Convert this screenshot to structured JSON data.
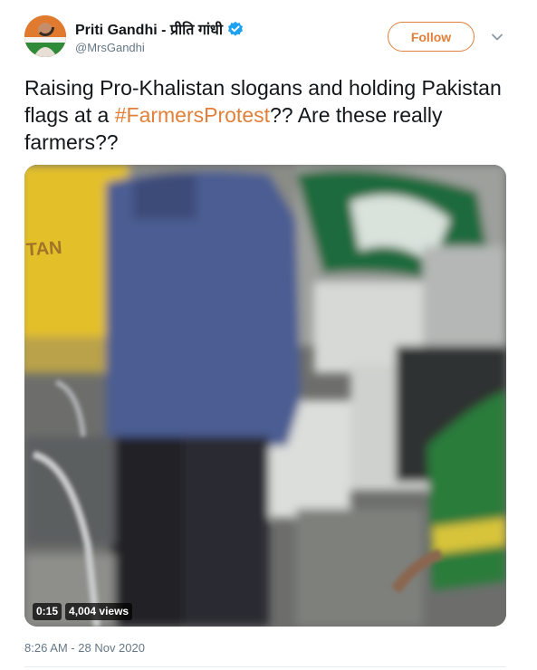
{
  "author": {
    "name": "Priti Gandhi - प्रीति गांधी",
    "handle": "@MrsGandhi",
    "verified_icon": "verified-badge-icon"
  },
  "actions": {
    "follow_label": "Follow",
    "menu_icon": "chevron-down-icon"
  },
  "tweet": {
    "text_before": "Raising Pro-Khalistan slogans and holding Pakistan flags at a ",
    "hashtag": "#FarmersProtest",
    "text_after": "?? Are these really farmers??",
    "timestamp": "8:26 AM - 28 Nov 2020"
  },
  "video": {
    "duration": "0:15",
    "views": "4,004 views",
    "sign_text": "TAN"
  },
  "colors": {
    "accent": "#e0803a",
    "text": "#14171a",
    "muted": "#657786",
    "verified": "#1da1f2"
  }
}
